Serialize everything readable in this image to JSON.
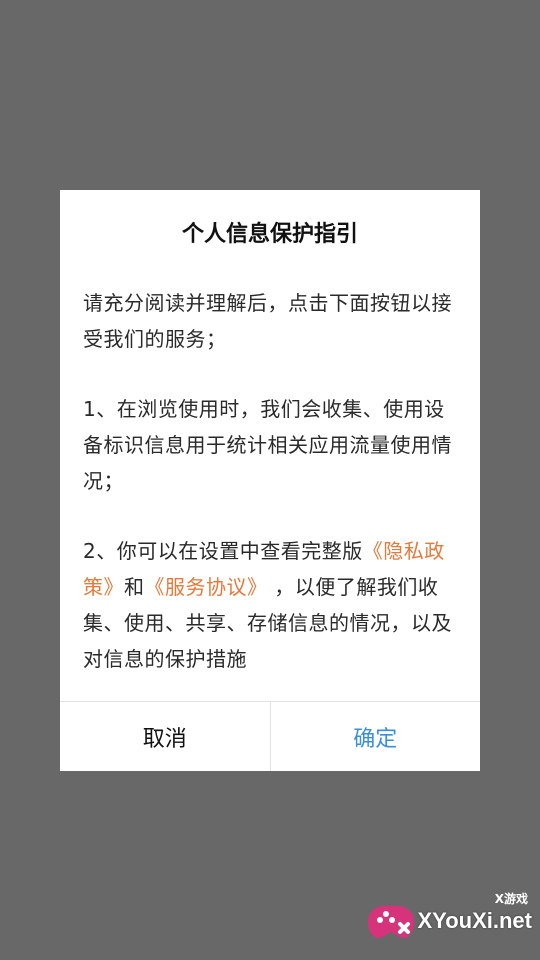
{
  "dialog": {
    "title": "个人信息保护指引",
    "intro": "请充分阅读并理解后，点击下面按钮以接受我们的服务；",
    "item1": " 1、在浏览使用时，我们会收集、使用设备标识信息用于统计相关应用流量使用情况；",
    "item2": {
      "prefix": " 2、你可以在设置中查看完整版",
      "privacy_link": "《隐私政策》",
      "and": "和",
      "service_link": "《服务协议》",
      "suffix": " ，以便了解我们收集、使用、共享、存储信息的情况，以及对信息的保护措施"
    },
    "cancel_label": "取消",
    "confirm_label": "确定"
  },
  "watermark": {
    "top_text": "X游戏",
    "main_text": "XYouXi.net"
  },
  "colors": {
    "overlay": "#686868",
    "link": "#e5793b",
    "confirm": "#3a8fd8"
  }
}
